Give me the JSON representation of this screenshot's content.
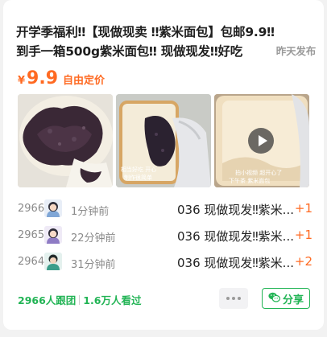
{
  "post": {
    "title_line1": "开学季福利‼【现做现卖 ‼紫米面包】包邮9.9‼",
    "title_line2": "到手一箱500g紫米面包‼ 现做现发‼好吃",
    "tag": "昨天发布",
    "price_currency": "¥",
    "price_value": "9.9",
    "price_desc": "自由定价",
    "image_captions": {
      "img2_caption": "相当好吃 开心 制作很简单",
      "img3_caption": "拍小视频 超开心了 下午茶 紫米面包"
    }
  },
  "activity": [
    {
      "num": "2966",
      "time": "1分钟前",
      "msg": "036 现做现发‼紫米...",
      "count": "+1",
      "avatar": "avatar-girl-icon"
    },
    {
      "num": "2965",
      "time": "22分钟前",
      "msg": "036 现做现发‼紫米...",
      "count": "+1",
      "avatar": "avatar-girl-purple-icon"
    },
    {
      "num": "2964",
      "time": "31分钟前",
      "msg": "036 现做现发‼紫米...",
      "count": "+2",
      "avatar": "avatar-boy-icon"
    }
  ],
  "footer": {
    "followers": "2966人跟团",
    "views": "1.6万人看过",
    "share_label": "分享"
  },
  "colors": {
    "accent_orange": "#ff6a22",
    "accent_green": "#22b455",
    "text_gray": "#8a8a8a"
  }
}
